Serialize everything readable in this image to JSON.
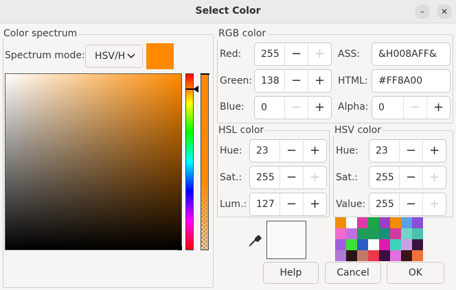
{
  "window": {
    "title": "Select Color",
    "minimize_glyph": "–",
    "close_glyph": "✕"
  },
  "spectrum": {
    "group_label": "Color spectrum",
    "mode_label": "Spectrum mode:",
    "mode_value": "HSV/H",
    "current_color": "#FF8A00",
    "hue_marker_fraction": 0.063,
    "value_marker_fraction": 1.0
  },
  "rgb": {
    "group_label": "RGB color",
    "red": {
      "label": "Red:",
      "value": "255"
    },
    "green": {
      "label": "Green:",
      "value": "138"
    },
    "blue": {
      "label": "Blue:",
      "value": "0"
    },
    "ass": {
      "label": "ASS:",
      "value": "&H008AFF&"
    },
    "html": {
      "label": "HTML:",
      "value": "#FF8A00"
    },
    "alpha": {
      "label": "Alpha:",
      "value": "0"
    }
  },
  "hsl": {
    "group_label": "HSL color",
    "hue": {
      "label": "Hue:",
      "value": "23"
    },
    "sat": {
      "label": "Sat.:",
      "value": "255"
    },
    "lum": {
      "label": "Lum.:",
      "value": "127"
    }
  },
  "hsv": {
    "group_label": "HSV color",
    "hue": {
      "label": "Hue:",
      "value": "23"
    },
    "sat": {
      "label": "Sat.:",
      "value": "255"
    },
    "value": {
      "label": "Value:",
      "value": "255"
    }
  },
  "spin": {
    "minus": "−",
    "plus": "+"
  },
  "swatches": [
    "#f28c00",
    "#ffffff",
    "#e03aa6",
    "#18a84a",
    "#9b3fc4",
    "#f28c00",
    "#5ea0e8",
    "#8a4fd6",
    "#f06bd1",
    "#c46fe0",
    "#1e9e5a",
    "#1e9e5a",
    "#1a8f7a",
    "#d13aa0",
    "#6ed6c8",
    "#48c2a8",
    "#a35ee0",
    "#3fe03a",
    "#2b5cc9",
    "#ffffff",
    "#e01ab0",
    "#3fd3b8",
    "#c9a0e8",
    "#3a1440",
    "#b078d8",
    "#2a1418",
    "#c07a6a",
    "#e8384a",
    "#3a1040",
    "#e070e0",
    "#3a1414",
    "#f0703a"
  ],
  "buttons": {
    "help": "Help",
    "cancel": "Cancel",
    "ok": "OK"
  },
  "icons": {
    "eyedropper": "eyedropper-icon"
  }
}
